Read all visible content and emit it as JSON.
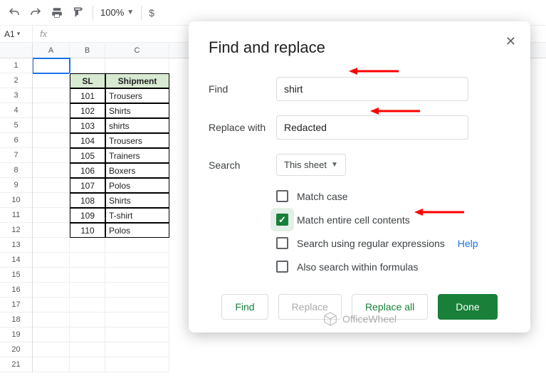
{
  "toolbar": {
    "zoom": "100%",
    "currency_symbol": "$"
  },
  "namebox": {
    "ref": "A1",
    "fx_label": "fx"
  },
  "columns": [
    "A",
    "B",
    "C"
  ],
  "rows_count": 21,
  "table": {
    "headers": {
      "sl": "SL",
      "shipment": "Shipment"
    },
    "rows": [
      {
        "sl": "101",
        "shipment": "Trousers"
      },
      {
        "sl": "102",
        "shipment": "Shirts"
      },
      {
        "sl": "103",
        "shipment": "shirts"
      },
      {
        "sl": "104",
        "shipment": "Trousers"
      },
      {
        "sl": "105",
        "shipment": "Trainers"
      },
      {
        "sl": "106",
        "shipment": "Boxers"
      },
      {
        "sl": "107",
        "shipment": "Polos"
      },
      {
        "sl": "108",
        "shipment": "Shirts"
      },
      {
        "sl": "109",
        "shipment": "T-shirt"
      },
      {
        "sl": "110",
        "shipment": "Polos"
      }
    ]
  },
  "dialog": {
    "title": "Find and replace",
    "labels": {
      "find": "Find",
      "replace": "Replace with",
      "search": "Search"
    },
    "find_value": "shirt",
    "replace_value": "Redacted",
    "search_scope": "This sheet",
    "options": {
      "match_case": "Match case",
      "match_entire": "Match entire cell contents",
      "regex": "Search using regular expressions",
      "regex_help": "Help",
      "formulas": "Also search within formulas"
    },
    "buttons": {
      "find": "Find",
      "replace": "Replace",
      "replace_all": "Replace all",
      "done": "Done"
    }
  },
  "watermark": "OfficeWheel"
}
